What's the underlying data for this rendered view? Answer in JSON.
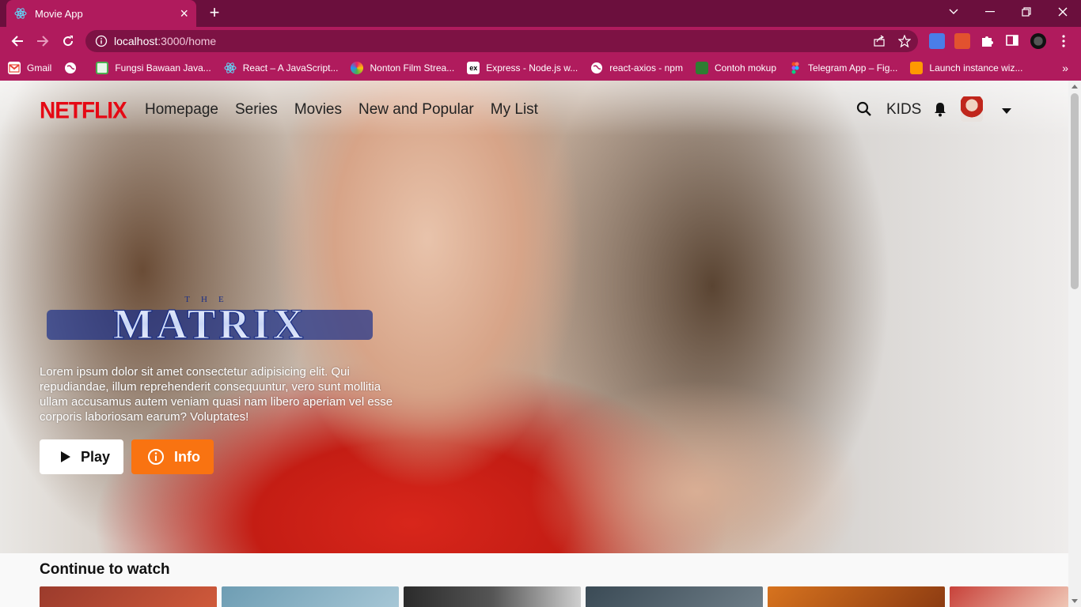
{
  "browser": {
    "tab_title": "Movie App",
    "url_host": "localhost",
    "url_path": ":3000/home",
    "bookmarks": [
      {
        "label": "Gmail",
        "color": "#ea4335"
      },
      {
        "label": "",
        "color": "#ffffff"
      },
      {
        "label": "Fungsi Bawaan Java...",
        "color": "#4caf50"
      },
      {
        "label": "React – A JavaScript...",
        "color": "#61dafb"
      },
      {
        "label": "Nonton Film Strea...",
        "color": "#e91e63"
      },
      {
        "label": "Express - Node.js w...",
        "color": "#ffffff"
      },
      {
        "label": "react-axios - npm",
        "color": "#ffffff"
      },
      {
        "label": "Contoh mokup",
        "color": "#2e7d32"
      },
      {
        "label": "Telegram App – Fig...",
        "color": "#f24e1e"
      },
      {
        "label": "Launch instance wiz...",
        "color": "#ff9900"
      }
    ]
  },
  "nav": {
    "logo": "NETFLIX",
    "menu": [
      "Homepage",
      "Series",
      "Movies",
      "New and Popular",
      "My List"
    ],
    "kids": "KIDS"
  },
  "hero": {
    "title_small": "THE",
    "title": "MATRIX",
    "description": "Lorem ipsum dolor sit amet consectetur adipisicing elit. Qui repudiandae, illum reprehenderit consequuntur, vero sunt mollitia ullam accusamus autem veniam quasi nam libero aperiam vel esse corporis laboriosam earum? Voluptates!",
    "play_label": "Play",
    "info_label": "Info"
  },
  "row": {
    "title": "Continue to watch",
    "thumb_colors": [
      "#9b3b2c",
      "#6e9db3",
      "#2b2b2b",
      "#3a4a55",
      "#d7731e",
      "#c8423a"
    ]
  },
  "colors": {
    "accent": "#b01b5d",
    "netflix_red": "#e50914",
    "info_orange": "#f97311"
  }
}
